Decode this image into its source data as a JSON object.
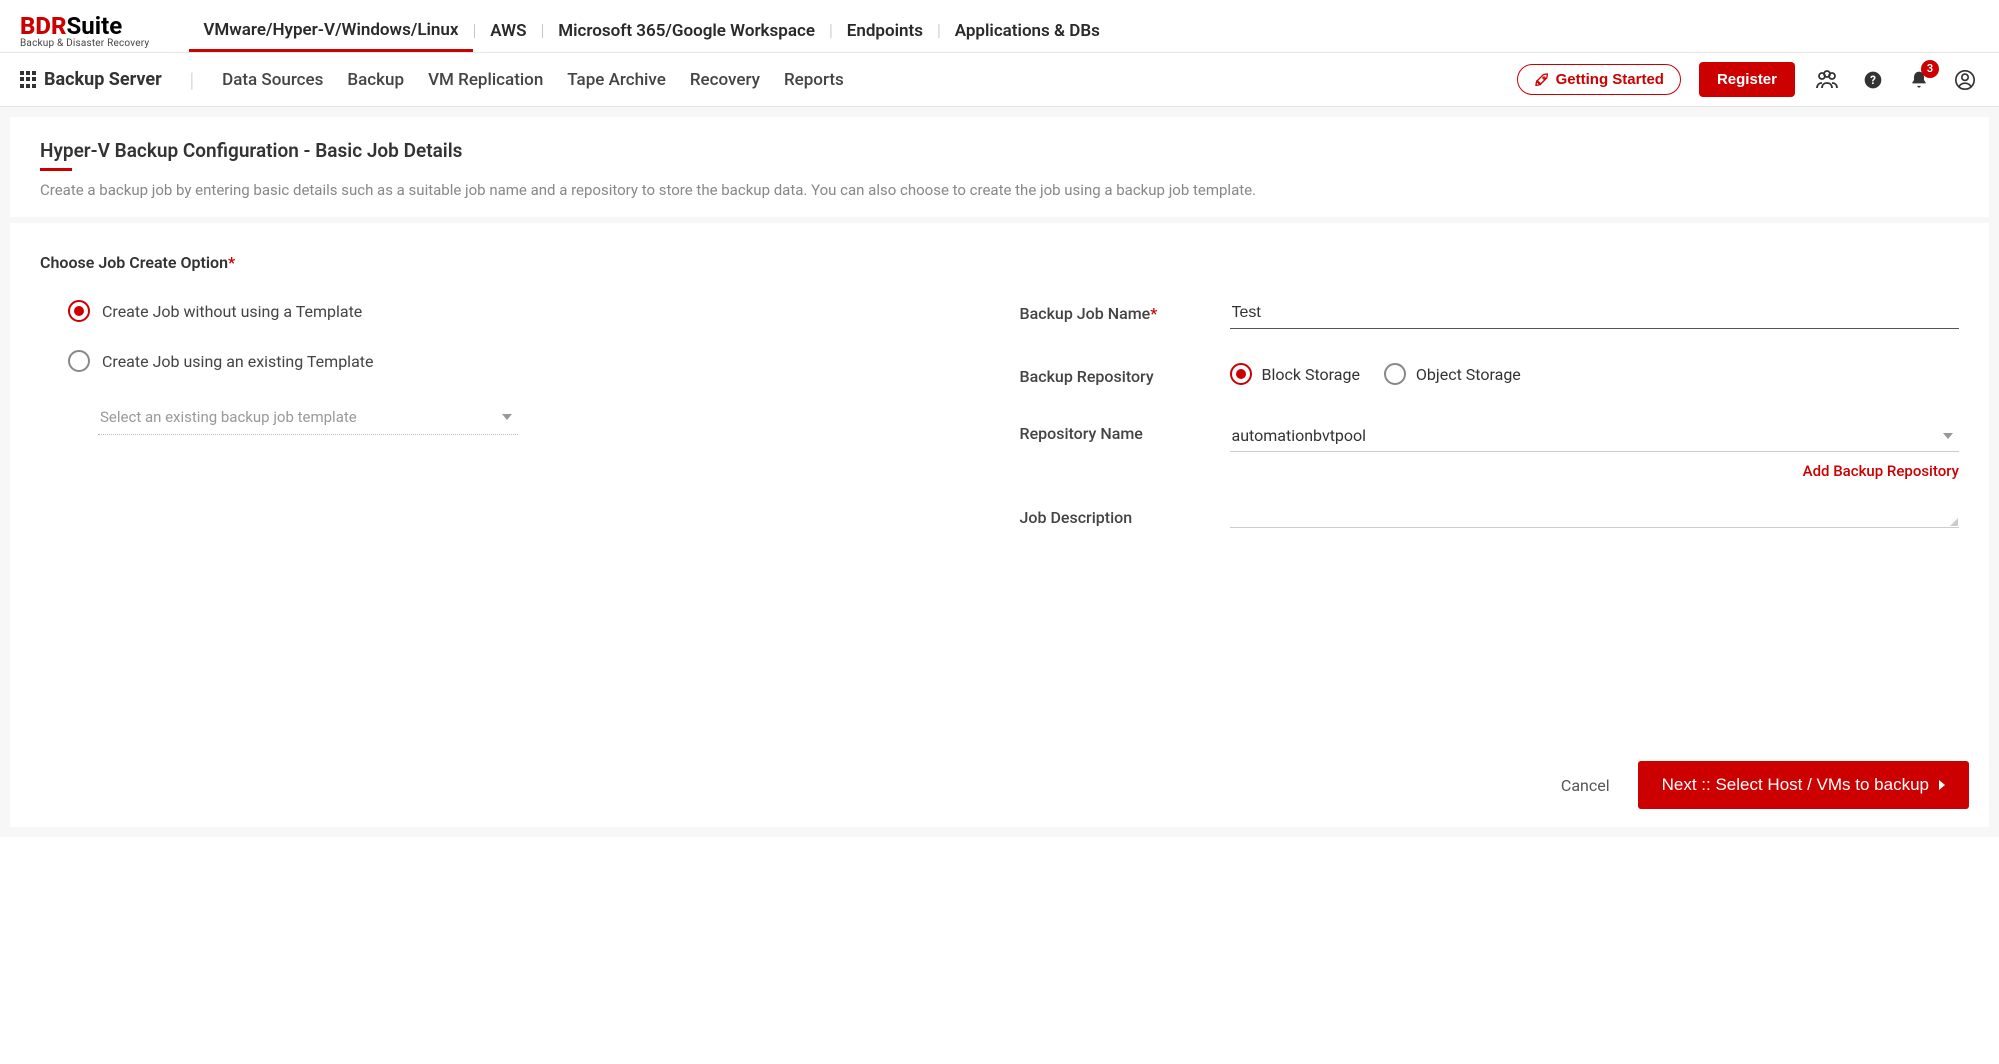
{
  "logo": {
    "prefix": "BDR",
    "suffix": "Suite",
    "tagline": "Backup & Disaster Recovery"
  },
  "topnav": {
    "items": [
      "VMware/Hyper-V/Windows/Linux",
      "AWS",
      "Microsoft 365/Google Workspace",
      "Endpoints",
      "Applications & DBs"
    ],
    "active_index": 0
  },
  "secondbar": {
    "context": "Backup Server",
    "items": [
      "Data Sources",
      "Backup",
      "VM Replication",
      "Tape Archive",
      "Recovery",
      "Reports"
    ],
    "getting_started": "Getting Started",
    "register": "Register",
    "notification_count": "3"
  },
  "page": {
    "title": "Hyper-V Backup Configuration - Basic Job Details",
    "description": "Create a backup job by entering basic details such as a suitable job name and a repository to store the backup data. You can also choose to create the job using a backup job template."
  },
  "form": {
    "choose_label": "Choose Job Create Option",
    "option_no_template": "Create Job without using a Template",
    "option_with_template": "Create Job using an existing Template",
    "template_placeholder": "Select an existing backup job template",
    "job_name_label": "Backup Job Name",
    "job_name_value": "Test",
    "repo_label": "Backup Repository",
    "repo_block": "Block Storage",
    "repo_object": "Object Storage",
    "repo_name_label": "Repository Name",
    "repo_name_value": "automationbvtpool",
    "add_repo_link": "Add Backup Repository",
    "desc_label": "Job Description",
    "desc_value": ""
  },
  "footer": {
    "cancel": "Cancel",
    "next": "Next :: Select Host / VMs to backup"
  }
}
